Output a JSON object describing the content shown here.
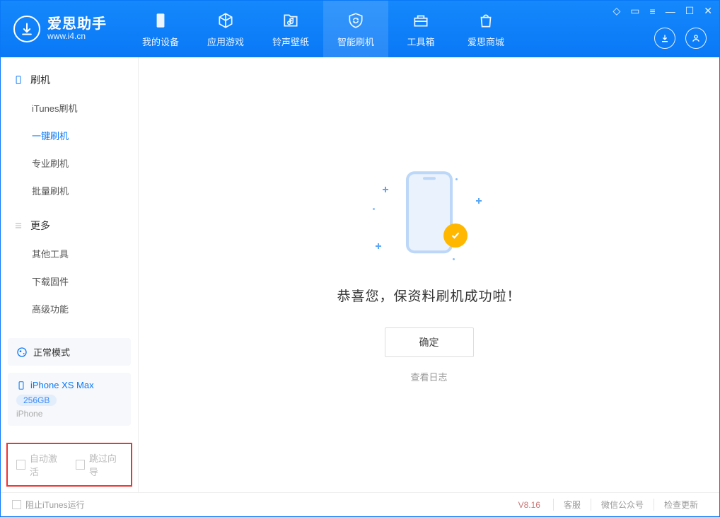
{
  "app": {
    "name_cn": "爱思助手",
    "name_en": "www.i4.cn"
  },
  "nav": {
    "tabs": [
      {
        "label": "我的设备"
      },
      {
        "label": "应用游戏"
      },
      {
        "label": "铃声壁纸"
      },
      {
        "label": "智能刷机"
      },
      {
        "label": "工具箱"
      },
      {
        "label": "爱思商城"
      }
    ]
  },
  "sidebar": {
    "sections": [
      {
        "title": "刷机",
        "items": [
          {
            "label": "iTunes刷机"
          },
          {
            "label": "一键刷机"
          },
          {
            "label": "专业刷机"
          },
          {
            "label": "批量刷机"
          }
        ]
      },
      {
        "title": "更多",
        "items": [
          {
            "label": "其他工具"
          },
          {
            "label": "下载固件"
          },
          {
            "label": "高级功能"
          }
        ]
      }
    ],
    "mode": "正常模式",
    "device": {
      "name": "iPhone XS Max",
      "capacity": "256GB",
      "type": "iPhone"
    },
    "checks": {
      "auto_activate": "自动激活",
      "skip_guide": "跳过向导"
    }
  },
  "main": {
    "success_text": "恭喜您，保资料刷机成功啦！",
    "ok_label": "确定",
    "view_log": "查看日志"
  },
  "status": {
    "block_itunes": "阻止iTunes运行",
    "version": "V8.16",
    "links": {
      "service": "客服",
      "wechat": "微信公众号",
      "update": "检查更新"
    }
  }
}
